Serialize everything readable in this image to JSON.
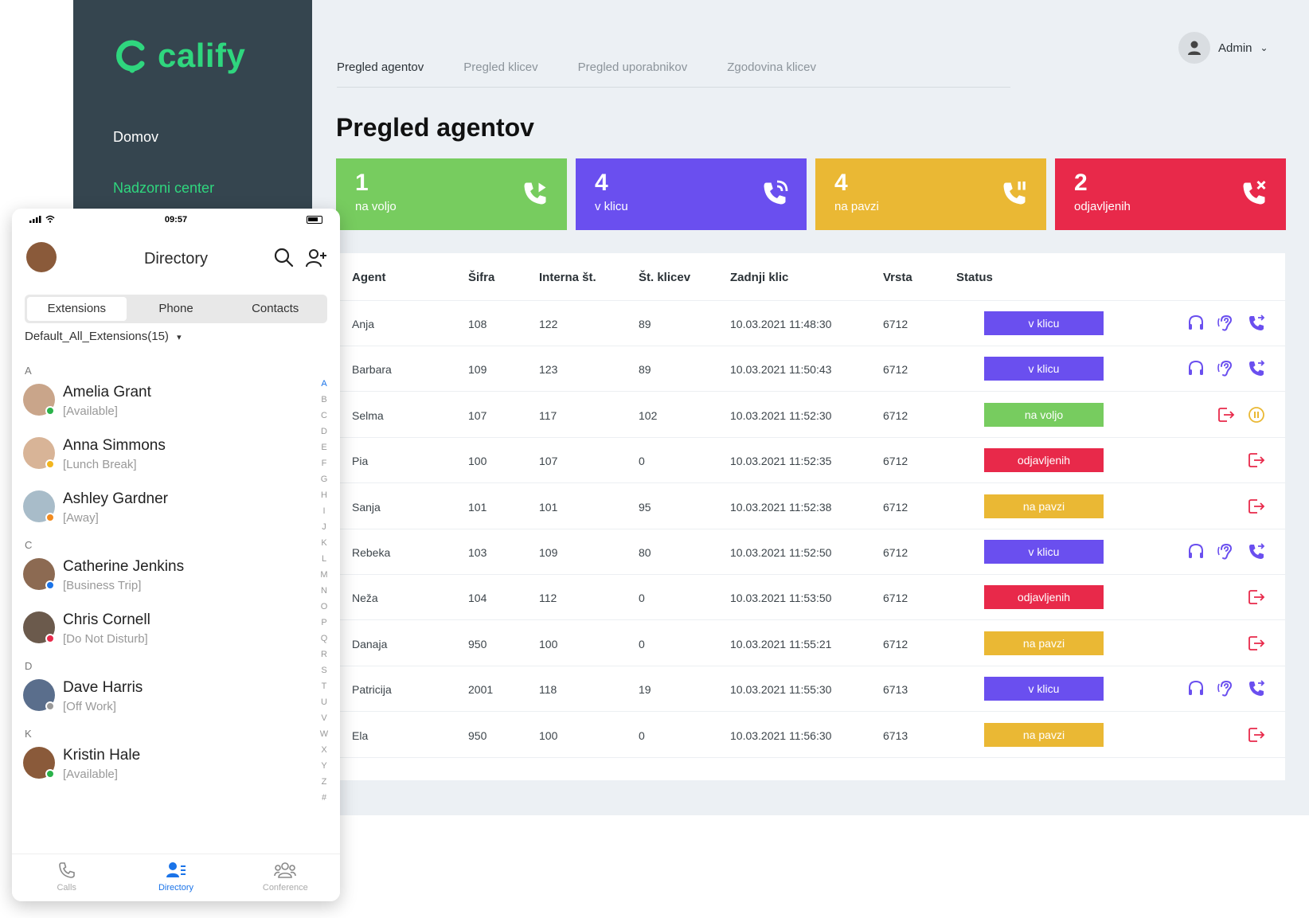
{
  "brand": {
    "name": "calify",
    "color": "#2fd67e"
  },
  "sidebar": {
    "items": [
      {
        "label": "Domov"
      },
      {
        "label": "Nadzorni center"
      }
    ]
  },
  "tabs": [
    {
      "label": "Pregled agentov",
      "active": true
    },
    {
      "label": "Pregled klicev",
      "active": false
    },
    {
      "label": "Pregled uporabnikov",
      "active": false
    },
    {
      "label": "Zgodovina klicev",
      "active": false
    }
  ],
  "user": {
    "name": "Admin",
    "icon": "user-icon"
  },
  "page": {
    "title": "Pregled agentov"
  },
  "cards": [
    {
      "value": "1",
      "label": "na voljo",
      "color": "#77cc5f",
      "icon": "phone-incoming-icon"
    },
    {
      "value": "4",
      "label": "v klicu",
      "color": "#6a4fef",
      "icon": "phone-active-icon"
    },
    {
      "value": "4",
      "label": "na pavzi",
      "color": "#eab834",
      "icon": "phone-pause-icon"
    },
    {
      "value": "2",
      "label": "odjavljenih",
      "color": "#e8294a",
      "icon": "phone-off-icon"
    }
  ],
  "status_colors": {
    "v klicu": "#6a4fef",
    "na voljo": "#77cc5f",
    "odjavljenih": "#e8294a",
    "na pavzi": "#eab834"
  },
  "table": {
    "headers": [
      "Agent",
      "Šifra",
      "Interna št.",
      "Št. klicev",
      "Zadnji klic",
      "Vrsta",
      "Status"
    ],
    "rows": [
      {
        "agent": "Anja",
        "sifra": "108",
        "interna": "122",
        "klicev": "89",
        "zadnji": "10.03.2021 11:48:30",
        "vrsta": "6712",
        "status": "v klicu",
        "actions": [
          "headset-icon",
          "ear-icon",
          "phone-transfer-icon"
        ]
      },
      {
        "agent": "Barbara",
        "sifra": "109",
        "interna": "123",
        "klicev": "89",
        "zadnji": "10.03.2021 11:50:43",
        "vrsta": "6712",
        "status": "v klicu",
        "actions": [
          "headset-icon",
          "ear-icon",
          "phone-transfer-icon"
        ]
      },
      {
        "agent": "Selma",
        "sifra": "107",
        "interna": "117",
        "klicev": "102",
        "zadnji": "10.03.2021 11:52:30",
        "vrsta": "6712",
        "status": "na voljo",
        "actions": [
          "logout-icon",
          "pause-icon"
        ]
      },
      {
        "agent": "Pia",
        "sifra": "100",
        "interna": "107",
        "klicev": "0",
        "zadnji": "10.03.2021 11:52:35",
        "vrsta": "6712",
        "status": "odjavljenih",
        "actions": [
          "logout-icon"
        ]
      },
      {
        "agent": "Sanja",
        "sifra": "101",
        "interna": "101",
        "klicev": "95",
        "zadnji": "10.03.2021 11:52:38",
        "vrsta": "6712",
        "status": "na pavzi",
        "actions": [
          "logout-icon"
        ]
      },
      {
        "agent": "Rebeka",
        "sifra": "103",
        "interna": "109",
        "klicev": "80",
        "zadnji": "10.03.2021 11:52:50",
        "vrsta": "6712",
        "status": "v klicu",
        "actions": [
          "headset-icon",
          "ear-icon",
          "phone-transfer-icon"
        ]
      },
      {
        "agent": "Neža",
        "sifra": "104",
        "interna": "112",
        "klicev": "0",
        "zadnji": "10.03.2021 11:53:50",
        "vrsta": "6712",
        "status": "odjavljenih",
        "actions": [
          "logout-icon"
        ]
      },
      {
        "agent": "Danaja",
        "sifra": "950",
        "interna": "100",
        "klicev": "0",
        "zadnji": "10.03.2021 11:55:21",
        "vrsta": "6712",
        "status": "na pavzi",
        "actions": [
          "logout-icon"
        ]
      },
      {
        "agent": "Patricija",
        "sifra": "2001",
        "interna": "118",
        "klicev": "19",
        "zadnji": "10.03.2021 11:55:30",
        "vrsta": "6713",
        "status": "v klicu",
        "actions": [
          "headset-icon",
          "ear-icon",
          "phone-transfer-icon"
        ]
      },
      {
        "agent": "Ela",
        "sifra": "950",
        "interna": "100",
        "klicev": "0",
        "zadnji": "10.03.2021 11:56:30",
        "vrsta": "6713",
        "status": "na pavzi",
        "actions": [
          "logout-icon"
        ]
      }
    ]
  },
  "phone": {
    "time": "09:57",
    "title": "Directory",
    "segments": [
      {
        "label": "Extensions",
        "active": true
      },
      {
        "label": "Phone",
        "active": false
      },
      {
        "label": "Contacts",
        "active": false
      }
    ],
    "filter": "Default_All_Extensions(15)",
    "sections": [
      {
        "letter": "A",
        "contacts": [
          {
            "name": "Amelia Grant",
            "status": "[Available]",
            "dot": "#2ab24a",
            "avatar": "#c9a58a"
          },
          {
            "name": "Anna  Simmons",
            "status": "[Lunch Break]",
            "dot": "#f2b51f",
            "avatar": "#d8b497"
          },
          {
            "name": "Ashley Gardner",
            "status": "[Away]",
            "dot": "#f28b1f",
            "avatar": "#a8bcc9"
          }
        ]
      },
      {
        "letter": "C",
        "contacts": [
          {
            "name": "Catherine Jenkins",
            "status": "[Business Trip]",
            "dot": "#1a73e8",
            "avatar": "#8c6a52"
          },
          {
            "name": "Chris Cornell",
            "status": "[Do Not Disturb]",
            "dot": "#e8294a",
            "avatar": "#6b5a4c"
          }
        ]
      },
      {
        "letter": "D",
        "contacts": [
          {
            "name": "Dave  Harris",
            "status": "[Off Work]",
            "dot": "#999999",
            "avatar": "#5a6e8c"
          }
        ]
      },
      {
        "letter": "K",
        "contacts": [
          {
            "name": "Kristin Hale",
            "status": "[Available]",
            "dot": "#2ab24a",
            "avatar": "#8a5a3a"
          }
        ]
      }
    ],
    "alphabet": [
      "A",
      "B",
      "C",
      "D",
      "E",
      "F",
      "G",
      "H",
      "I",
      "J",
      "K",
      "L",
      "M",
      "N",
      "O",
      "P",
      "Q",
      "R",
      "S",
      "T",
      "U",
      "V",
      "W",
      "X",
      "Y",
      "Z",
      "#"
    ],
    "bottom_nav": [
      {
        "label": "Calls",
        "icon": "phone-icon",
        "active": false
      },
      {
        "label": "Directory",
        "icon": "directory-icon",
        "active": true
      },
      {
        "label": "Conference",
        "icon": "conference-icon",
        "active": false
      }
    ]
  }
}
